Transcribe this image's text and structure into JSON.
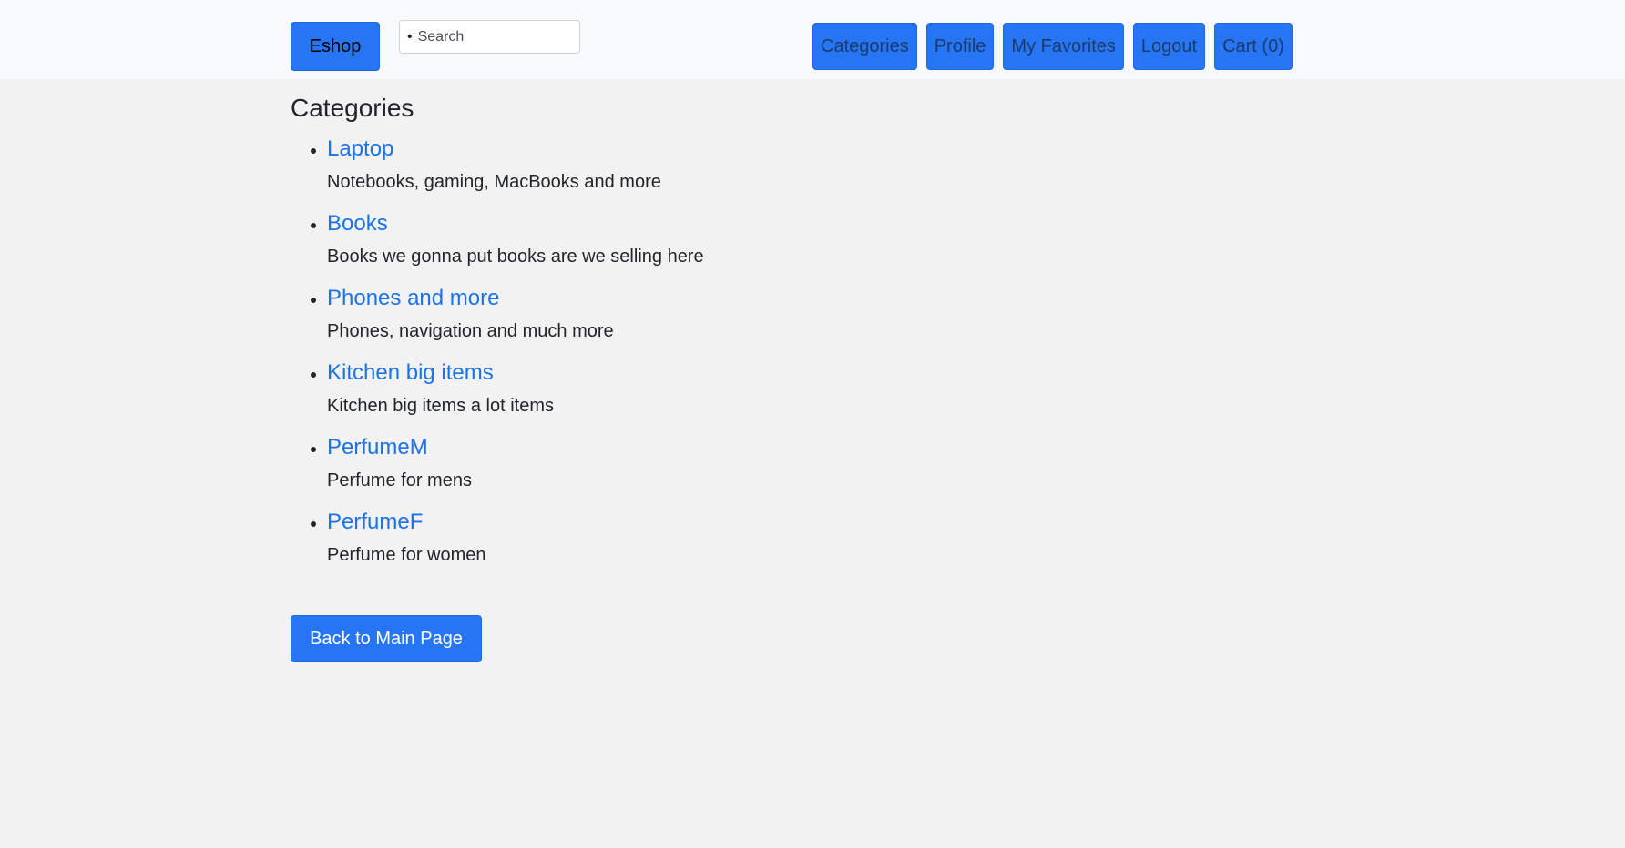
{
  "navbar": {
    "brand": "Eshop",
    "search": {
      "bullet": "•",
      "placeholder": "Search",
      "value": ""
    },
    "links": [
      {
        "label": "Categories"
      },
      {
        "label": "Profile"
      },
      {
        "label": "My Favorites"
      },
      {
        "label": "Logout"
      },
      {
        "label": "Cart (0)"
      }
    ]
  },
  "main": {
    "title": "Categories",
    "categories": [
      {
        "name": "Laptop",
        "description": "Notebooks, gaming, MacBooks and more"
      },
      {
        "name": "Books",
        "description": "Books we gonna put books are we selling here"
      },
      {
        "name": "Phones and more",
        "description": "Phones, navigation and much more"
      },
      {
        "name": "Kitchen big items",
        "description": "Kitchen big items a lot items"
      },
      {
        "name": "PerfumeM",
        "description": "Perfume for mens"
      },
      {
        "name": "PerfumeF",
        "description": "Perfume for women"
      }
    ],
    "back_label": "Back to Main Page"
  },
  "colors": {
    "primary": "#2575f5",
    "link": "#1a73e8",
    "page_bg": "#f2f2f2",
    "navbar_bg": "#f8f9fa"
  }
}
